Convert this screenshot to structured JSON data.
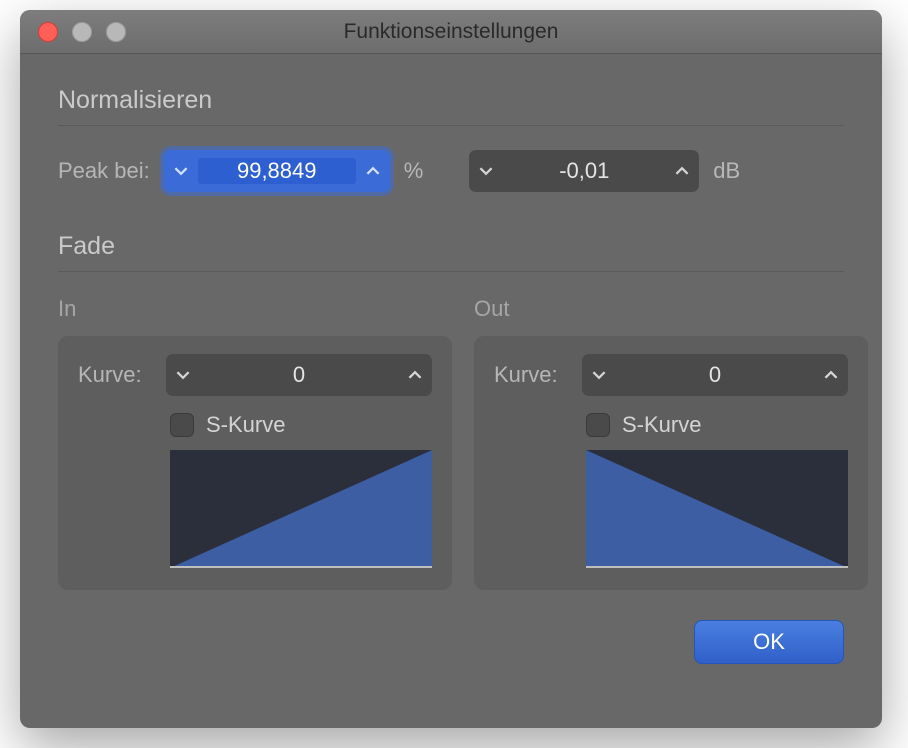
{
  "window": {
    "title": "Funktionseinstellungen"
  },
  "normalize": {
    "section_title": "Normalisieren",
    "peak_label": "Peak bei:",
    "percent_value": "99,8849",
    "percent_unit": "%",
    "db_value": "-0,01",
    "db_unit": "dB"
  },
  "fade": {
    "section_title": "Fade",
    "in": {
      "heading": "In",
      "curve_label": "Kurve:",
      "curve_value": "0",
      "s_curve_label": "S-Kurve",
      "s_curve_checked": false
    },
    "out": {
      "heading": "Out",
      "curve_label": "Kurve:",
      "curve_value": "0",
      "s_curve_label": "S-Kurve",
      "s_curve_checked": false
    }
  },
  "buttons": {
    "ok": "OK"
  }
}
